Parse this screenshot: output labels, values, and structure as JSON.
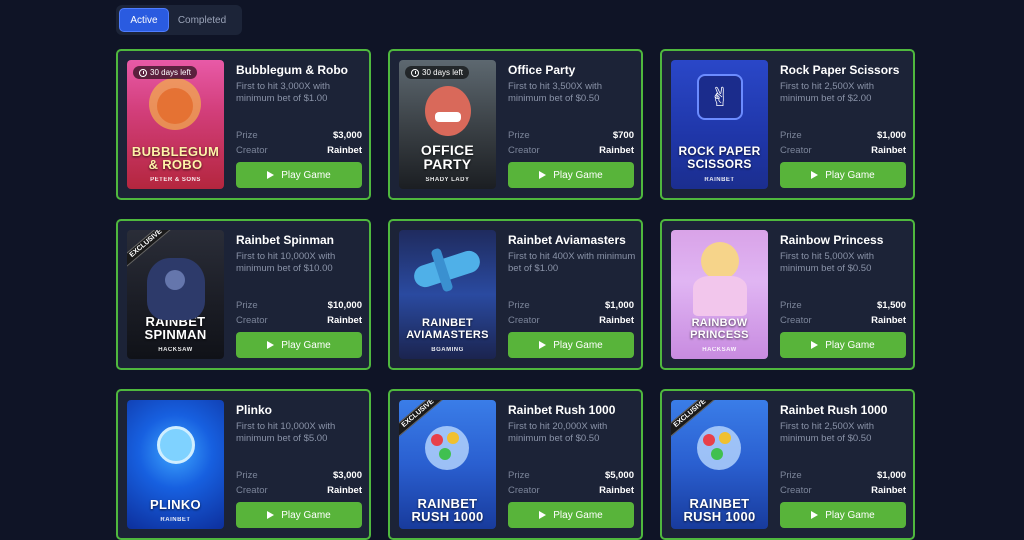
{
  "tabs": [
    {
      "label": "Active",
      "active": true
    },
    {
      "label": "Completed",
      "active": false
    }
  ],
  "labels": {
    "prize": "Prize",
    "creator": "Creator",
    "play": "Play Game"
  },
  "cards": [
    {
      "title": "Bubblegum & Robo",
      "desc": "First to hit 3,000X with minimum bet of $1.00",
      "prize": "$3,000",
      "creator": "Rainbet",
      "days_left": "30 days left",
      "art_title": "BUBBLEGUM & ROBO",
      "studio": "PETER & SONS",
      "exclusive": false
    },
    {
      "title": "Office Party",
      "desc": "First to hit 3,500X with minimum bet of $0.50",
      "prize": "$700",
      "creator": "Rainbet",
      "days_left": "30 days left",
      "art_title": "OFFICE PARTY",
      "studio": "SHADY LADY",
      "exclusive": false
    },
    {
      "title": "Rock Paper Scissors",
      "desc": "First to hit 2,500X with minimum bet of $2.00",
      "prize": "$1,000",
      "creator": "Rainbet",
      "days_left": "",
      "art_title": "ROCK PAPER SCISSORS",
      "studio": "RAINBET",
      "exclusive": false
    },
    {
      "title": "Rainbet Spinman",
      "desc": "First to hit 10,000X with minimum bet of $10.00",
      "prize": "$10,000",
      "creator": "Rainbet",
      "days_left": "",
      "art_title": "RAINBET SPINMAN",
      "studio": "HACKSAW",
      "exclusive": true,
      "exclusive_label": "EXCLUSIVE"
    },
    {
      "title": "Rainbet Aviamasters",
      "desc": "First to hit 400X with minimum bet of $1.00",
      "prize": "$1,000",
      "creator": "Rainbet",
      "days_left": "",
      "art_title": "RAINBET AVIAMASTERS",
      "studio": "BGAMING",
      "exclusive": false
    },
    {
      "title": "Rainbow Princess",
      "desc": "First to hit 5,000X with minimum bet of $0.50",
      "prize": "$1,500",
      "creator": "Rainbet",
      "days_left": "",
      "art_title": "RAINBOW PRINCESS",
      "studio": "HACKSAW",
      "exclusive": false
    },
    {
      "title": "Plinko",
      "desc": "First to hit 10,000X with minimum bet of $5.00",
      "prize": "$3,000",
      "creator": "Rainbet",
      "days_left": "",
      "art_title": "PLINKO",
      "studio": "RAINBET",
      "exclusive": false
    },
    {
      "title": "Rainbet Rush 1000",
      "desc": "First to hit 20,000X with minimum bet of $0.50",
      "prize": "$5,000",
      "creator": "Rainbet",
      "days_left": "",
      "art_title": "RAINBET RUSH 1000",
      "studio": "",
      "exclusive": true,
      "exclusive_label": "EXCLUSIVE"
    },
    {
      "title": "Rainbet Rush 1000",
      "desc": "First to hit 2,500X with minimum bet of $0.50",
      "prize": "$1,000",
      "creator": "Rainbet",
      "days_left": "",
      "art_title": "RAINBET RUSH 1000",
      "studio": "",
      "exclusive": true,
      "exclusive_label": "EXCLUSIVE"
    }
  ],
  "colors": {
    "background": "#0f1426",
    "card": "#1c2337",
    "card_border": "#4fb83e",
    "play_button": "#58b43a",
    "active_tab": "#2a5be0"
  }
}
